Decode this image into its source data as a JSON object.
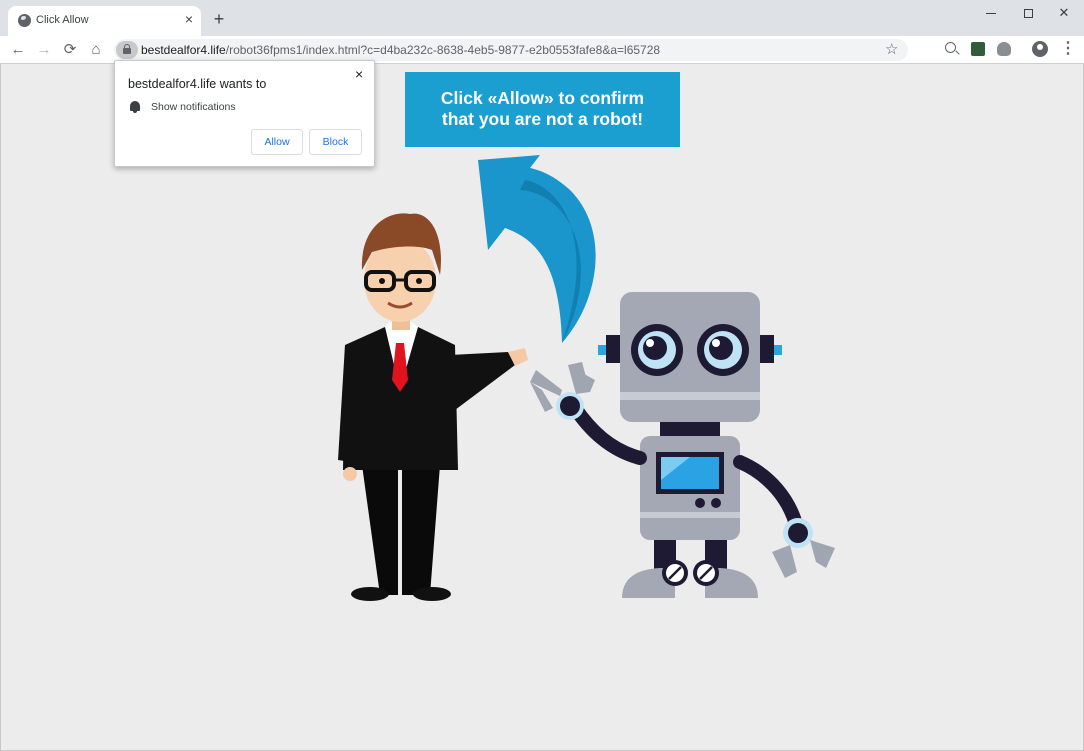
{
  "browser": {
    "tab": {
      "title": "Click Allow",
      "close_glyph": "×",
      "favicon": "globe-icon"
    },
    "new_tab_glyph": "+",
    "window_controls": {
      "close_glyph": "✕"
    },
    "nav": {
      "back_glyph": "←",
      "forward_glyph": "→",
      "reload_glyph": "⟳",
      "home_glyph": "⌂"
    },
    "address": {
      "host": "bestdealfor4.life",
      "path": "/robot36fpms1/index.html?c=d4ba232c-8638-4eb5-9877-e2b0553fafe8&a=l65728"
    },
    "bookmark_glyph": "☆",
    "menu_glyph": "⋮"
  },
  "permission_prompt": {
    "title": "bestdealfor4.life wants to",
    "item": "Show notifications",
    "close_glyph": "×",
    "allow_label": "Allow",
    "block_label": "Block"
  },
  "page": {
    "banner_line1": "Click «Allow» to confirm",
    "banner_line2": "that you are not a robot!",
    "banner_color": "#1b9fd1",
    "background_color": "#ececec"
  }
}
